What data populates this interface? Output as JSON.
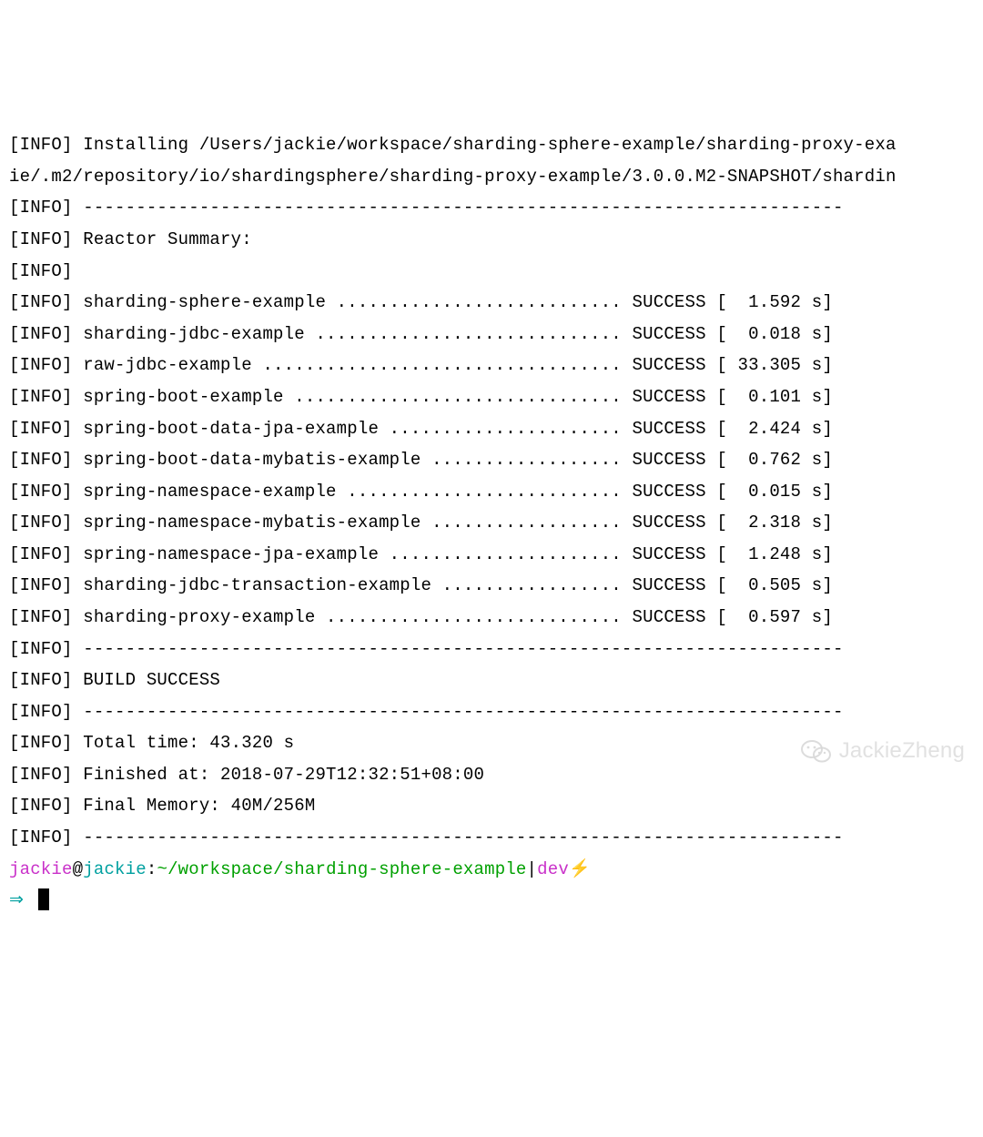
{
  "installLine1": "[INFO] Installing /Users/jackie/workspace/sharding-sphere-example/sharding-proxy-exa",
  "installLine2": "ie/.m2/repository/io/shardingsphere/sharding-proxy-example/3.0.0.M2-SNAPSHOT/shardin",
  "divider": "[INFO] ------------------------------------------------------------------------",
  "reactorHeader": "[INFO] Reactor Summary:",
  "emptyInfo": "[INFO]",
  "reactor": [
    {
      "name": "sharding-sphere-example",
      "dots": "...........................",
      "status": "SUCCESS",
      "time": "1.592 s"
    },
    {
      "name": "sharding-jdbc-example",
      "dots": ".............................",
      "status": "SUCCESS",
      "time": "0.018 s"
    },
    {
      "name": "raw-jdbc-example",
      "dots": "..................................",
      "status": "SUCCESS",
      "time": "33.305 s"
    },
    {
      "name": "spring-boot-example",
      "dots": "...............................",
      "status": "SUCCESS",
      "time": "0.101 s"
    },
    {
      "name": "spring-boot-data-jpa-example",
      "dots": "......................",
      "status": "SUCCESS",
      "time": "2.424 s"
    },
    {
      "name": "spring-boot-data-mybatis-example",
      "dots": "..................",
      "status": "SUCCESS",
      "time": "0.762 s"
    },
    {
      "name": "spring-namespace-example",
      "dots": "..........................",
      "status": "SUCCESS",
      "time": "0.015 s"
    },
    {
      "name": "spring-namespace-mybatis-example",
      "dots": "..................",
      "status": "SUCCESS",
      "time": "2.318 s"
    },
    {
      "name": "spring-namespace-jpa-example",
      "dots": "......................",
      "status": "SUCCESS",
      "time": "1.248 s"
    },
    {
      "name": "sharding-jdbc-transaction-example",
      "dots": ".................",
      "status": "SUCCESS",
      "time": "0.505 s"
    },
    {
      "name": "sharding-proxy-example",
      "dots": "............................",
      "status": "SUCCESS",
      "time": "0.597 s"
    }
  ],
  "buildSuccess": "[INFO] BUILD SUCCESS",
  "totalTime": "[INFO] Total time: 43.320 s",
  "finishedAt": "[INFO] Finished at: 2018-07-29T12:32:51+08:00",
  "finalMemory": "[INFO] Final Memory: 40M/256M",
  "prompt": {
    "user": "jackie",
    "at": "@",
    "host": "jackie",
    "colon": ":",
    "path": "~/workspace/sharding-sphere-example",
    "pipe": "|",
    "branch": "dev",
    "lightning": "⚡"
  },
  "arrow": "⇒",
  "watermark": "JackieZheng"
}
